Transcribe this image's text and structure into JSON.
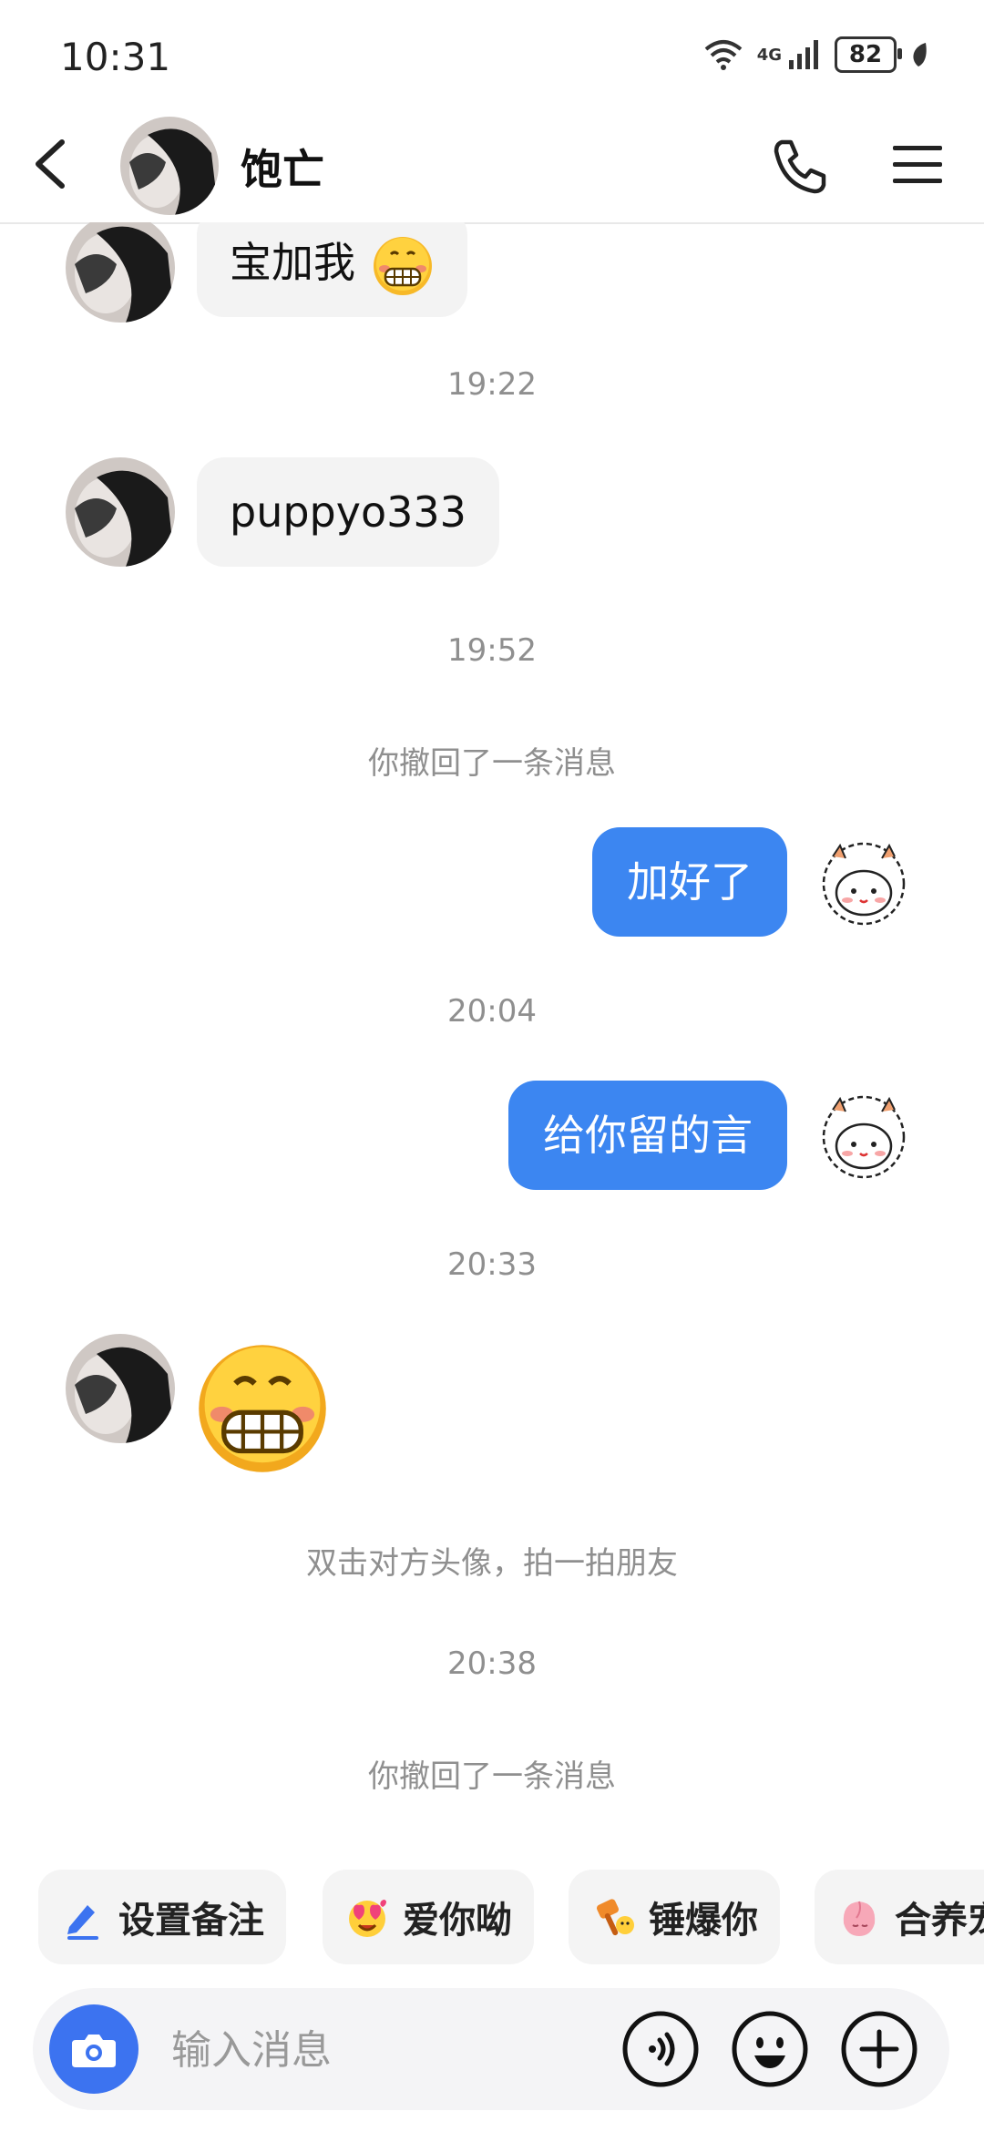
{
  "status_bar": {
    "time": "10:31",
    "battery": "82",
    "network": "4G"
  },
  "header": {
    "contact_name": "饱亡"
  },
  "messages": {
    "m1_text": "宝加我",
    "t1": "19:22",
    "m2_text": "puppyo333",
    "t2": "19:52",
    "sys1": "你撤回了一条消息",
    "m3_text": "加好了",
    "t3": "20:04",
    "m4_text": "给你留的言",
    "t4": "20:33",
    "sys2": "双击对方头像，拍一拍朋友",
    "t5": "20:38",
    "sys3": "你撤回了一条消息"
  },
  "quick_actions": [
    {
      "label": "设置备注",
      "icon": "pencil-icon"
    },
    {
      "label": "爱你呦",
      "icon": "heart-eyes-icon"
    },
    {
      "label": "锤爆你",
      "icon": "hammer-icon"
    },
    {
      "label": "合养宠",
      "icon": "peach-pet-icon"
    }
  ],
  "input": {
    "placeholder": "输入消息"
  },
  "colors": {
    "accent": "#3c86f1",
    "bubble_in": "#f3f3f3",
    "timestamp": "#8f8f8f"
  }
}
